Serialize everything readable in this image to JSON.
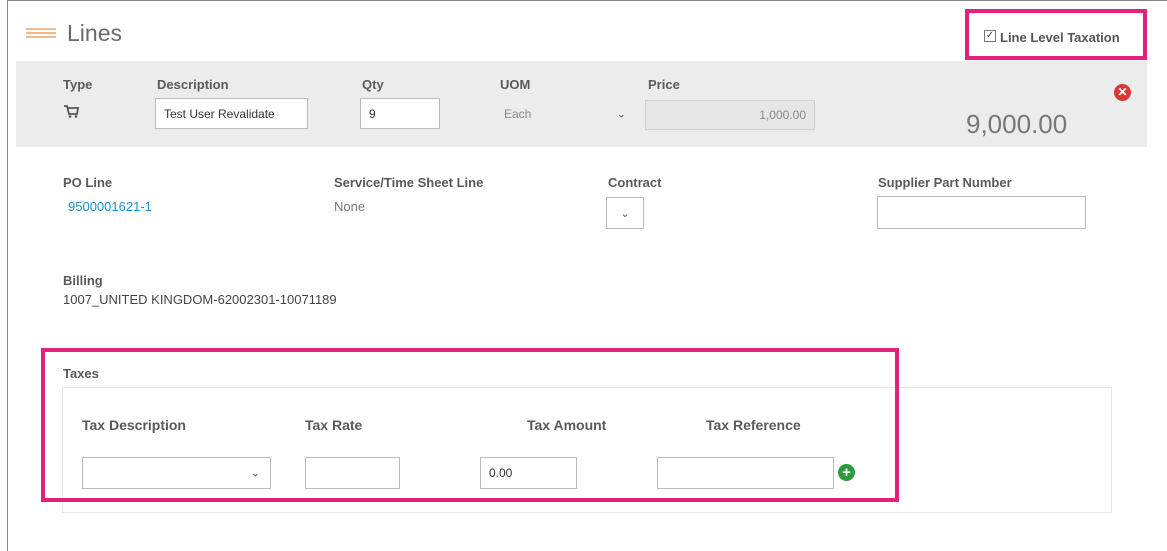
{
  "section": {
    "title": "Lines"
  },
  "line_level_taxation": {
    "label": "Line Level Taxation",
    "checked": true,
    "check_glyph": "✓"
  },
  "line": {
    "type_label": "Type",
    "description_label": "Description",
    "description_value": "Test User Revalidate",
    "qty_label": "Qty",
    "qty_value": "9",
    "uom_label": "UOM",
    "uom_value": "Each",
    "price_label": "Price",
    "price_value": "1,000.00",
    "total": "9,000.00",
    "remove_glyph": "✕"
  },
  "details": {
    "po_line_label": "PO Line",
    "po_line_value": "9500001621-1",
    "service_label": "Service/Time Sheet Line",
    "service_value": "None",
    "contract_label": "Contract",
    "supplier_part_label": "Supplier Part Number",
    "supplier_part_value": "",
    "billing_label": "Billing",
    "billing_value": "1007_UNITED KINGDOM-62002301-10071189"
  },
  "taxes": {
    "title": "Taxes",
    "headers": {
      "description": "Tax Description",
      "rate": "Tax Rate",
      "amount": "Tax Amount",
      "reference": "Tax Reference"
    },
    "row": {
      "description": "",
      "rate": "",
      "amount": "0.00",
      "reference": ""
    },
    "add_glyph": "+"
  },
  "glyphs": {
    "caret": "⌄"
  },
  "colors": {
    "highlight": "#e0237a",
    "link": "#1a8fd4",
    "remove": "#d93838",
    "add": "#2e9a3c"
  }
}
